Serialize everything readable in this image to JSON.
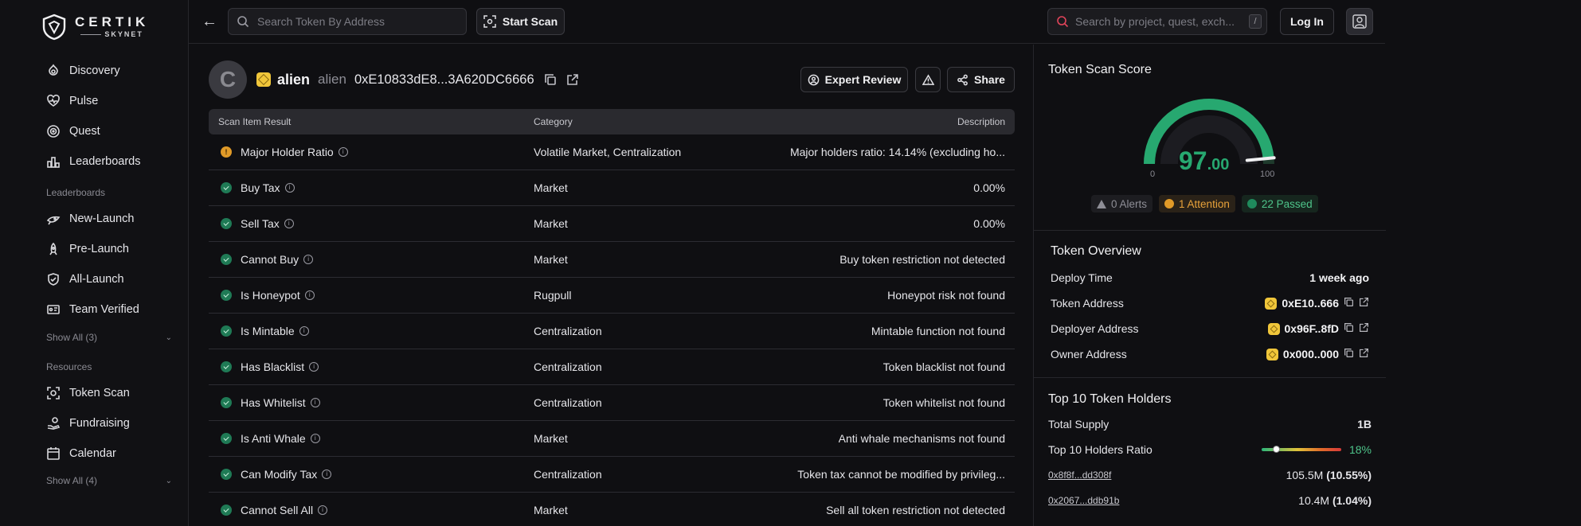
{
  "brand": {
    "name": "CERTIK",
    "sub": "SKYNET"
  },
  "sidebar": {
    "items": [
      {
        "label": "Discovery",
        "icon": "discovery-icon"
      },
      {
        "label": "Pulse",
        "icon": "pulse-icon"
      },
      {
        "label": "Quest",
        "icon": "quest-icon"
      },
      {
        "label": "Leaderboards",
        "icon": "leaderboards-icon"
      }
    ],
    "section_leaderboards": "Leaderboards",
    "leaderboards": [
      {
        "label": "New-Launch",
        "icon": "new-launch-icon"
      },
      {
        "label": "Pre-Launch",
        "icon": "pre-launch-icon"
      },
      {
        "label": "All-Launch",
        "icon": "all-launch-icon"
      },
      {
        "label": "Team Verified",
        "icon": "team-verified-icon"
      }
    ],
    "show_all_1": "Show All (3)",
    "section_resources": "Resources",
    "resources": [
      {
        "label": "Token Scan",
        "icon": "token-scan-icon"
      },
      {
        "label": "Fundraising",
        "icon": "fundraising-icon"
      },
      {
        "label": "Calendar",
        "icon": "calendar-icon"
      }
    ],
    "show_all_2": "Show All (4)"
  },
  "topbar": {
    "search_placeholder": "Search Token By Address",
    "start_scan": "Start Scan",
    "search2_placeholder": "Search by project, quest, exch...",
    "kbd": "/",
    "login": "Log In"
  },
  "token": {
    "name": "alien",
    "symbol": "alien",
    "address": "0xE10833dE8...3A620DC6666",
    "logo_glyph": "C"
  },
  "actions": {
    "expert_review": "Expert Review",
    "share": "Share"
  },
  "table": {
    "headers": [
      "Scan Item Result",
      "Category",
      "Description"
    ],
    "rows": [
      {
        "status": "warn",
        "name": "Major Holder Ratio",
        "category": "Volatile Market, Centralization",
        "desc": "Major holders ratio: 14.14% (excluding ho..."
      },
      {
        "status": "pass",
        "name": "Buy Tax",
        "category": "Market",
        "desc": "0.00%"
      },
      {
        "status": "pass",
        "name": "Sell Tax",
        "category": "Market",
        "desc": "0.00%"
      },
      {
        "status": "pass",
        "name": "Cannot Buy",
        "category": "Market",
        "desc": "Buy token restriction not detected"
      },
      {
        "status": "pass",
        "name": "Is Honeypot",
        "category": "Rugpull",
        "desc": "Honeypot risk not found"
      },
      {
        "status": "pass",
        "name": "Is Mintable",
        "category": "Centralization",
        "desc": "Mintable function not found"
      },
      {
        "status": "pass",
        "name": "Has Blacklist",
        "category": "Centralization",
        "desc": "Token blacklist not found"
      },
      {
        "status": "pass",
        "name": "Has Whitelist",
        "category": "Centralization",
        "desc": "Token whitelist not found"
      },
      {
        "status": "pass",
        "name": "Is Anti Whale",
        "category": "Market",
        "desc": "Anti whale mechanisms not found"
      },
      {
        "status": "pass",
        "name": "Can Modify Tax",
        "category": "Centralization",
        "desc": "Token tax cannot be modified by privileg..."
      },
      {
        "status": "pass",
        "name": "Cannot Sell All",
        "category": "Market",
        "desc": "Sell all token restriction not detected"
      }
    ]
  },
  "score_panel": {
    "title": "Token Scan Score",
    "score_int": "97",
    "score_dec": ".00",
    "score_value": 97,
    "min": "0",
    "max": "100",
    "alerts": "0 Alerts",
    "attention": "1 Attention",
    "passed": "22 Passed",
    "colors": {
      "good": "#27a870",
      "warn": "#e8a23a"
    }
  },
  "overview": {
    "title": "Token Overview",
    "rows": [
      {
        "label": "Deploy Time",
        "value": "1 week ago"
      },
      {
        "label": "Token Address",
        "value": "0xE10..666"
      },
      {
        "label": "Deployer Address",
        "value": "0x96F..8fD"
      },
      {
        "label": "Owner Address",
        "value": "0x000..000"
      }
    ]
  },
  "holders": {
    "title": "Top 10 Token Holders",
    "total_supply_label": "Total Supply",
    "total_supply": "1B",
    "ratio_label": "Top 10 Holders Ratio",
    "ratio": "18%",
    "ratio_value": 0.18,
    "list": [
      {
        "addr": "0x8f8f...dd308f",
        "amount": "105.5M",
        "pct": "(10.55%)"
      },
      {
        "addr": "0x2067...ddb91b",
        "amount": "10.4M",
        "pct": "(1.04%)"
      }
    ]
  }
}
